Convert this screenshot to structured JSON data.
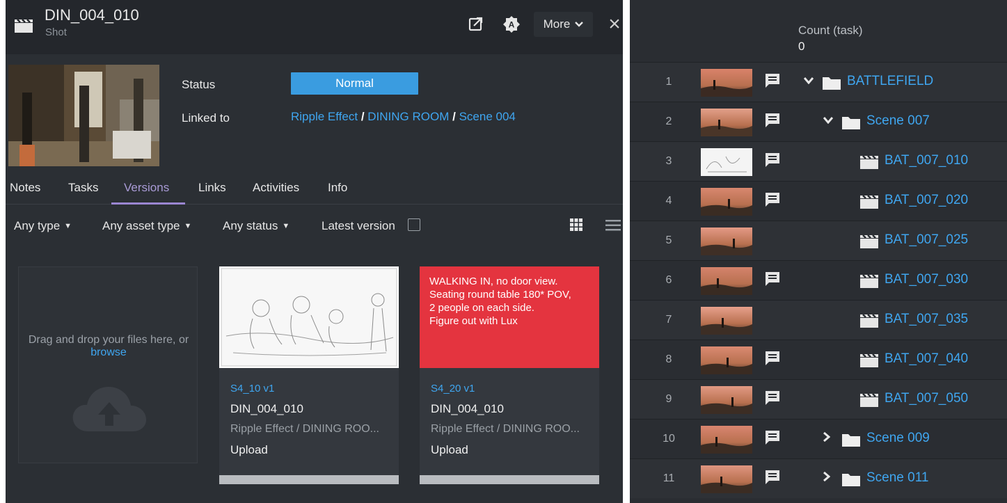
{
  "left": {
    "header": {
      "title": "DIN_004_010",
      "subtitle": "Shot",
      "more_label": "More",
      "close_glyph": "×"
    },
    "fields": {
      "status_label": "Status",
      "status_value": "Normal",
      "status_color": "#3a9ce0",
      "linked_label": "Linked to",
      "linked_path": [
        "Ripple Effect",
        "DINING ROOM",
        "Scene 004"
      ],
      "linked_separator": "/"
    },
    "tabs": [
      "Notes",
      "Tasks",
      "Versions",
      "Links",
      "Activities",
      "Info"
    ],
    "active_tab": "Versions",
    "filters": {
      "type": "Any type",
      "asset_type": "Any asset type",
      "status": "Any status",
      "latest_version_label": "Latest version",
      "latest_version_checked": false
    },
    "dropzone": {
      "text": "Drag and drop your files here, or",
      "link": "browse"
    },
    "versions": [
      {
        "name": "S4_10 v1",
        "shot": "DIN_004_010",
        "path": "Ripple Effect / DINING ROO...",
        "action": "Upload",
        "preview": "sketch"
      },
      {
        "name": "S4_20 v1",
        "shot": "DIN_004_010",
        "path": "Ripple Effect / DINING ROO...",
        "action": "Upload",
        "preview": "note",
        "note_lines": [
          "WALKING IN, no door view.",
          "Seating round table 180* POV,",
          "2 people on each side.",
          "Figure out with Lux"
        ]
      }
    ]
  },
  "right": {
    "column_header": "Count (task)",
    "count_value": "0",
    "rows": [
      {
        "num": "1",
        "name": "BATTLEFIELD",
        "kind": "folder",
        "level": 0,
        "expanded": true,
        "has_note": true
      },
      {
        "num": "2",
        "name": "Scene 007",
        "kind": "folder",
        "level": 1,
        "expanded": true,
        "has_note": true
      },
      {
        "num": "3",
        "name": "BAT_007_010",
        "kind": "shot",
        "level": 2,
        "has_note": true
      },
      {
        "num": "4",
        "name": "BAT_007_020",
        "kind": "shot",
        "level": 2,
        "has_note": true
      },
      {
        "num": "5",
        "name": "BAT_007_025",
        "kind": "shot",
        "level": 2,
        "has_note": false
      },
      {
        "num": "6",
        "name": "BAT_007_030",
        "kind": "shot",
        "level": 2,
        "has_note": true
      },
      {
        "num": "7",
        "name": "BAT_007_035",
        "kind": "shot",
        "level": 2,
        "has_note": false
      },
      {
        "num": "8",
        "name": "BAT_007_040",
        "kind": "shot",
        "level": 2,
        "has_note": true
      },
      {
        "num": "9",
        "name": "BAT_007_050",
        "kind": "shot",
        "level": 2,
        "has_note": true
      },
      {
        "num": "10",
        "name": "Scene 009",
        "kind": "folder",
        "level": 1,
        "expanded": false,
        "has_note": true
      },
      {
        "num": "11",
        "name": "Scene 011",
        "kind": "folder",
        "level": 1,
        "expanded": false,
        "has_note": true
      }
    ]
  },
  "colors": {
    "accent_link": "#3fa6f0",
    "active_tab": "#a99bd6",
    "note_card": "#e4343f"
  }
}
